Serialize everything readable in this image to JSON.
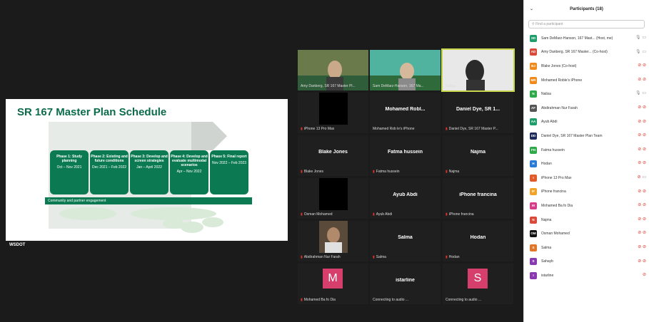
{
  "slide": {
    "title": "SR 167 Master Plan Schedule",
    "phases": [
      {
        "name": "Phase 1: Study planning",
        "dates": "Oct – Nov 2021"
      },
      {
        "name": "Phase 2: Existing and future conditions",
        "dates": "Dec 2021 – Feb 2022"
      },
      {
        "name": "Phase 3: Develop and screen strategies",
        "dates": "Jan – April 2022"
      },
      {
        "name": "Phase 4: Develop and evaluate multimodal scenarios",
        "dates": "Apr – Nov 2022"
      },
      {
        "name": "Phase 5: Final report",
        "dates": "Nov 2022 – Feb 2023"
      }
    ],
    "community_label": "Community and partner engagement",
    "logo": "WSDOT"
  },
  "tiles": [
    {
      "label": "Amy Danberg, SR 167 Master Pl...",
      "kind": "video"
    },
    {
      "label": "Sam DeMarz-Hanson, 167 Ma...",
      "kind": "video"
    },
    {
      "label": "Salina",
      "kind": "video"
    },
    {
      "label": "iPhone 13 Pro Max",
      "kind": "black"
    },
    {
      "center": "Mohamed Robl...",
      "label": "Mohamed Rob le's iPhone",
      "kind": "name"
    },
    {
      "center": "Daniel Dye, SR 1...",
      "label": "Daniel Dye, SR 167 Master P...",
      "kind": "name"
    },
    {
      "center": "Blake Jones",
      "label": "Blake Jones",
      "kind": "name"
    },
    {
      "center": "Fatma hussein",
      "label": "Fatma hussein",
      "kind": "name"
    },
    {
      "center": "Najma",
      "label": "Najma",
      "kind": "name"
    },
    {
      "label": "Osman Mohamed",
      "kind": "black"
    },
    {
      "center": "Ayub Abdi",
      "label": "Ayub Abdi",
      "kind": "name"
    },
    {
      "center": "iPhone francina",
      "label": "iPhone francina",
      "kind": "name"
    },
    {
      "label": "Abdirahman Nur Farah",
      "kind": "video"
    },
    {
      "center": "Salma",
      "label": "Salma",
      "kind": "name"
    },
    {
      "center": "Hodan",
      "label": "Hodan",
      "kind": "name"
    },
    {
      "avatar": "M",
      "label": "Mohamed Ba fo Dia",
      "kind": "avatar",
      "color": "#d63e6c"
    },
    {
      "center": "istarline",
      "label": "Connecting to audio ...",
      "kind": "name"
    },
    {
      "avatar": "S",
      "label": "Connecting to audio ...",
      "kind": "avatar",
      "color": "#d63e6c"
    }
  ],
  "panel": {
    "title": "Participants (18)",
    "search_placeholder": "Find a participant",
    "participants": [
      {
        "initials": "SD",
        "name": "Sam DeMarz-Hanson, 167 Mast... (Host, me)",
        "color": "#1f9d6b"
      },
      {
        "initials": "AD",
        "name": "Amy Danberg, SR 167 Master... (Co-host)",
        "color": "#d94a3a"
      },
      {
        "initials": "BJ",
        "name": "Blake Jones (Co-host)",
        "color": "#f08a1c"
      },
      {
        "initials": "MR",
        "name": "Mohamed Roble's iPhone",
        "color": "#f08a1c"
      },
      {
        "initials": "N",
        "name": "Nalisa",
        "color": "#2eaa4a"
      },
      {
        "initials": "AF",
        "name": "Abdirahman Nur Farah",
        "color": "#555555"
      },
      {
        "initials": "AA",
        "name": "Ayub Abdi",
        "color": "#1f9d6b"
      },
      {
        "initials": "DD",
        "name": "Daniel Dye, SR 167 Master Plan Team",
        "color": "#1d2a5a"
      },
      {
        "initials": "FH",
        "name": "Fatma hussein",
        "color": "#2eaa4a"
      },
      {
        "initials": "H",
        "name": "Hodan",
        "color": "#2a7bd6"
      },
      {
        "initials": "I",
        "name": "iPhone 13 Pro Max",
        "color": "#e05a2a"
      },
      {
        "initials": "IF",
        "name": "iPhone francina",
        "color": "#f0a52a"
      },
      {
        "initials": "M",
        "name": "Mohamed Ba fo Dia",
        "color": "#d63e8a"
      },
      {
        "initials": "N",
        "name": "Najma",
        "color": "#d94a3a"
      },
      {
        "initials": "OM",
        "name": "Osman Mohamed",
        "color": "#111111"
      },
      {
        "initials": "S",
        "name": "Salma",
        "color": "#e0762a"
      },
      {
        "initials": "S",
        "name": "Sahayb",
        "color": "#8a3ab0"
      },
      {
        "initials": "I",
        "name": "istarline",
        "color": "#8a3ab0"
      }
    ]
  }
}
